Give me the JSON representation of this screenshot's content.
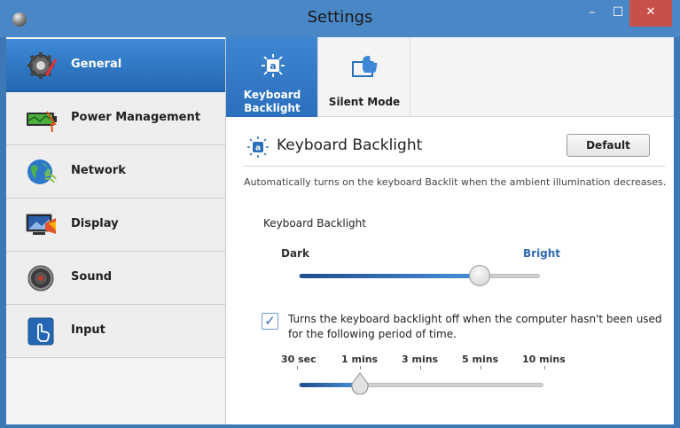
{
  "window": {
    "title": "Settings",
    "minimize": "–",
    "maximize": "☐",
    "close": "✕"
  },
  "sidebar": {
    "items": [
      {
        "label": "General",
        "icon": "gear-icon",
        "active": true
      },
      {
        "label": "Power Management",
        "icon": "battery-icon"
      },
      {
        "label": "Network",
        "icon": "globe-icon"
      },
      {
        "label": "Display",
        "icon": "display-icon"
      },
      {
        "label": "Sound",
        "icon": "speaker-icon"
      },
      {
        "label": "Input",
        "icon": "touch-icon"
      }
    ]
  },
  "tabs": [
    {
      "label": "Keyboard Backlight",
      "icon": "keyboard-backlight-icon",
      "active": true
    },
    {
      "label": "Silent Mode",
      "icon": "silent-mode-icon"
    }
  ],
  "section": {
    "title": "Keyboard Backlight",
    "default_button": "Default",
    "description": "Automatically turns on the keyboard Backlit when the ambient illumination decreases."
  },
  "backlight_slider": {
    "label": "Keyboard Backlight",
    "min_label": "Dark",
    "max_label": "Bright",
    "value": 0.75
  },
  "auto_off": {
    "checked": true,
    "check_mark": "✓",
    "text": "Turns the keyboard backlight off when the computer hasn't been used for the following period of time."
  },
  "timeout_slider": {
    "options": [
      "30 sec",
      "1 mins",
      "3 mins",
      "5 mins",
      "10 mins"
    ],
    "selected_index": 1
  },
  "colors": {
    "accent": "#2a6fbc",
    "titlebar": "#4a87c6",
    "close": "#c7504a"
  }
}
